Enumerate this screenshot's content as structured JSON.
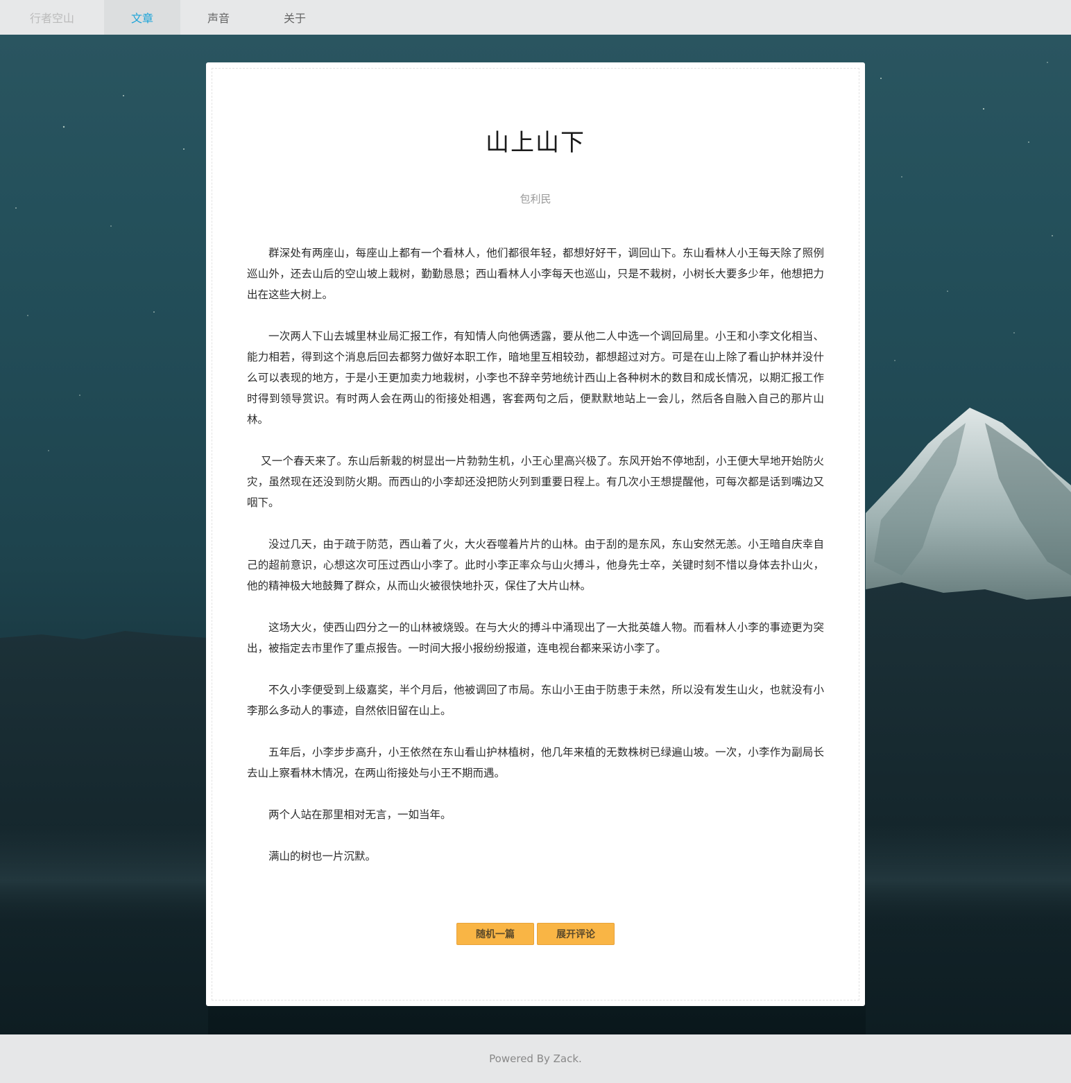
{
  "nav": {
    "brand": "行者空山",
    "items": [
      {
        "label": "文章",
        "active": true
      },
      {
        "label": "声音",
        "active": false
      },
      {
        "label": "关于",
        "active": false
      }
    ]
  },
  "article": {
    "title": "山上山下",
    "author": "包利民",
    "paragraphs": [
      "群深处有两座山，每座山上都有一个看林人，他们都很年轻，都想好好干，调回山下。东山看林人小王每天除了照例巡山外，还去山后的空山坡上栽树，勤勤恳恳；西山看林人小李每天也巡山，只是不栽树，小树长大要多少年，他想把力出在这些大树上。",
      "一次两人下山去城里林业局汇报工作，有知情人向他俩透露，要从他二人中选一个调回局里。小王和小李文化相当、能力相若，得到这个消息后回去都努力做好本职工作，暗地里互相较劲，都想超过对方。可是在山上除了看山护林并没什么可以表现的地方，于是小王更加卖力地栽树，小李也不辞辛劳地统计西山上各种树木的数目和成长情况，以期汇报工作时得到领导赏识。有时两人会在两山的衔接处相遇，客套两句之后，便默默地站上一会儿，然后各自融入自己的那片山林。",
      "又一个春天来了。东山后新栽的树显出一片勃勃生机，小王心里高兴极了。东风开始不停地刮，小王便大早地开始防火灾，虽然现在还没到防火期。而西山的小李却还没把防火列到重要日程上。有几次小王想提醒他，可每次都是话到嘴边又咽下。",
      "没过几天，由于疏于防范，西山着了火，大火吞噬着片片的山林。由于刮的是东风，东山安然无恙。小王暗自庆幸自己的超前意识，心想这次可压过西山小李了。此时小李正率众与山火搏斗，他身先士卒，关键时刻不惜以身体去扑山火，他的精神极大地鼓舞了群众，从而山火被很快地扑灭，保住了大片山林。",
      "这场大火，使西山四分之一的山林被烧毁。在与大火的搏斗中涌现出了一大批英雄人物。而看林人小李的事迹更为突出，被指定去市里作了重点报告。一时间大报小报纷纷报道，连电视台都来采访小李了。",
      "不久小李便受到上级嘉奖，半个月后，他被调回了市局。东山小王由于防患于未然，所以没有发生山火，也就没有小李那么多动人的事迹，自然依旧留在山上。",
      "五年后，小李步步高升，小王依然在东山看山护林植树，他几年来植的无数株树已绿遍山坡。一次，小李作为副局长去山上察看林木情况，在两山衔接处与小王不期而遇。",
      "两个人站在那里相对无言，一如当年。",
      "满山的树也一片沉默。"
    ],
    "buttons": {
      "random": "随机一篇",
      "comments": "展开评论"
    }
  },
  "footer": {
    "text": "Powered By Zack."
  },
  "colors": {
    "nav_active": "#1da4d8",
    "button": "#f9b545"
  }
}
